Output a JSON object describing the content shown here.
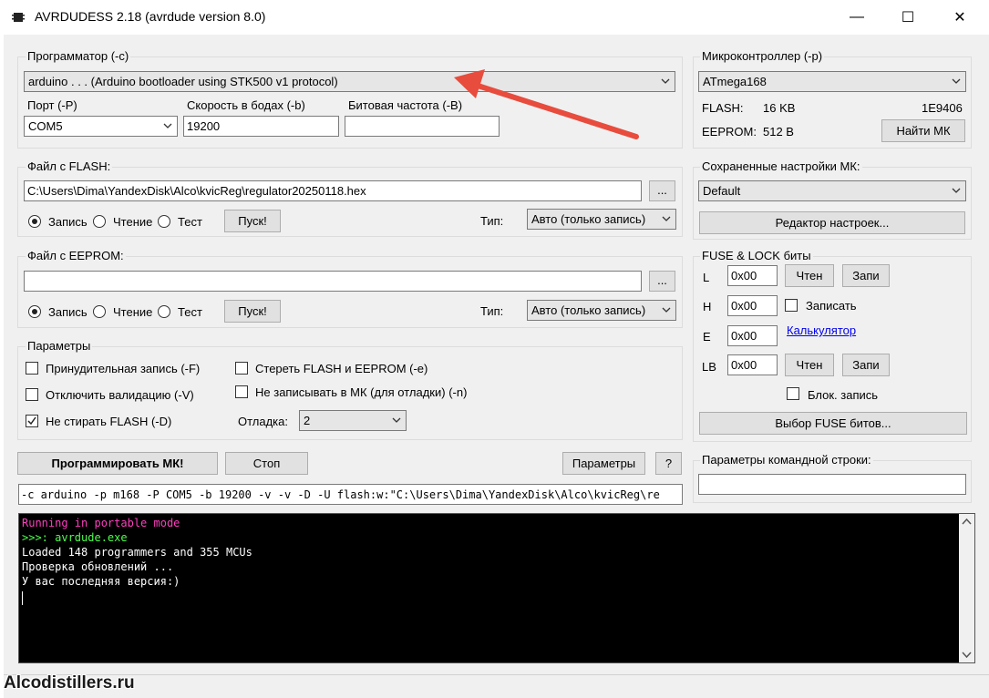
{
  "window": {
    "title": "AVRDUDESS 2.18 (avrdude version 8.0)",
    "minimize_glyph": "—",
    "maximize_glyph": "☐",
    "close_glyph": "✕"
  },
  "programmer": {
    "group_label": "Программатор (-c)",
    "selected": "arduino . . . (Arduino bootloader using STK500 v1 protocol)",
    "port_label": "Порт (-P)",
    "port_value": "COM5",
    "baud_label": "Скорость в бодах (-b)",
    "baud_value": "19200",
    "bitclock_label": "Битовая частота (-B)",
    "bitclock_value": ""
  },
  "mcu": {
    "group_label": "Микроконтроллер (-p)",
    "selected": "ATmega168",
    "flash_label": "FLASH:",
    "flash_value": "16 KB",
    "signature": "1E9406",
    "eeprom_label": "EEPROM:",
    "eeprom_value": "512 B",
    "find_button": "Найти МК"
  },
  "flash": {
    "group_label": "Файл с FLASH:",
    "path": "C:\\Users\\Dima\\YandexDisk\\Alco\\kvicReg\\regulator20250118.hex",
    "browse": "...",
    "write": "Запись",
    "read": "Чтение",
    "verify": "Тест",
    "go": "Пуск!",
    "type_label": "Тип:",
    "type_value": "Авто (только запись)"
  },
  "eeprom": {
    "group_label": "Файл с EEPROM:",
    "path": "",
    "browse": "...",
    "write": "Запись",
    "read": "Чтение",
    "verify": "Тест",
    "go": "Пуск!",
    "type_label": "Тип:",
    "type_value": "Авто (только запись)"
  },
  "presets": {
    "group_label": "Сохраненные настройки МК:",
    "selected": "Default",
    "editor_button": "Редактор настроек..."
  },
  "fuses": {
    "group_label": "FUSE & LOCK биты",
    "l_label": "L",
    "l_value": "0x00",
    "h_label": "H",
    "h_value": "0x00",
    "e_label": "E",
    "e_value": "0x00",
    "lb_label": "LB",
    "lb_value": "0x00",
    "read_button": "Чтен",
    "write_button": "Запи",
    "write_check": "Записать",
    "calculator": "Калькулятор",
    "lock_write": "Блок. запись",
    "select_button": "Выбор FUSE битов..."
  },
  "options": {
    "group_label": "Параметры",
    "force": "Принудительная запись (-F)",
    "disable_verify": "Отключить валидацию (-V)",
    "no_erase": "Не стирать FLASH (-D)",
    "erase": "Стереть FLASH и EEPROM (-e)",
    "no_write": "Не записывать в МК (для отладки) (-n)",
    "debug_label": "Отладка:",
    "debug_value": "2"
  },
  "actions": {
    "program": "Программировать МК!",
    "stop": "Стоп",
    "params": "Параметры",
    "help": "?"
  },
  "cmd": {
    "group_label": "Параметры командной строки:",
    "value": "",
    "generated": "-c arduino -p m168 -P COM5 -b 19200 -v -v -D -U flash:w:\"C:\\Users\\Dima\\YandexDisk\\Alco\\kvicReg\\re"
  },
  "console": {
    "lines": [
      {
        "text": "Running in portable mode",
        "color": "#ff3fbf"
      },
      {
        "text": ">>>: avrdude.exe",
        "color": "#4cff4c"
      },
      {
        "text": "Loaded 148 programmers and 355 MCUs",
        "color": "#ffffff"
      },
      {
        "text": "Проверка обновлений ...",
        "color": "#ffffff"
      },
      {
        "text": "У вас последняя версия:)",
        "color": "#ffffff"
      }
    ]
  },
  "watermark": "Alcodistillers.ru",
  "accent_color": "#e84c3d"
}
